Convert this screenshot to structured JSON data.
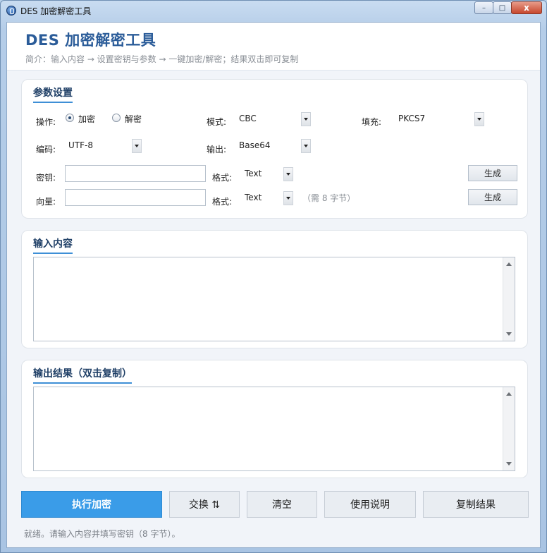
{
  "window": {
    "title": "DES 加密解密工具"
  },
  "caption_buttons": {
    "minimize": "–",
    "maximize": "□",
    "close": "x"
  },
  "header": {
    "title": "DES 加密解密工具",
    "subtitle": "简介：输入内容 → 设置密钥与参数 → 一键加密/解密；结果双击即可复制"
  },
  "params": {
    "heading": "参数设置",
    "operation": {
      "label": "操作:",
      "options": [
        "加密",
        "解密"
      ],
      "selected": "加密"
    },
    "mode": {
      "label": "模式:",
      "value": "CBC"
    },
    "padding": {
      "label": "填充:",
      "value": "PKCS7"
    },
    "encoding": {
      "label": "编码:",
      "value": "UTF-8"
    },
    "output": {
      "label": "输出:",
      "value": "Base64"
    },
    "key": {
      "label": "密钥:",
      "value": "",
      "format_label": "格式:",
      "format": "Text",
      "generate": "生成"
    },
    "iv": {
      "label": "向量:",
      "value": "",
      "format_label": "格式:",
      "format": "Text",
      "hint": "（需 8 字节）",
      "generate": "生成"
    }
  },
  "input_section": {
    "heading": "输入内容",
    "value": ""
  },
  "output_section": {
    "heading": "输出结果（双击复制）",
    "value": ""
  },
  "actions": {
    "execute": "执行加密",
    "swap": "交换 ⇅",
    "clear": "清空",
    "help": "使用说明",
    "copy": "复制结果"
  },
  "status": "就绪。请输入内容并填写密钥（8 字节）。",
  "colors": {
    "accent": "#3a9ce8",
    "title": "#2b5c99",
    "heading_underline": "#3e8fd6"
  }
}
